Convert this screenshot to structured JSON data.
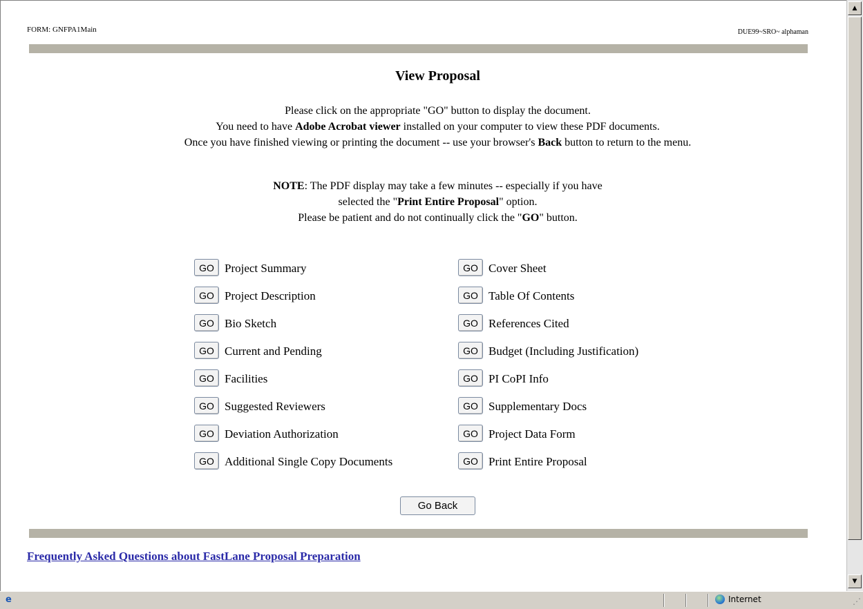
{
  "header": {
    "form_id": "FORM: GNFPA1Main",
    "session_id": "DUE99~SRO~ alphaman"
  },
  "page_title": "View Proposal",
  "intro": {
    "line1": "Please click on the appropriate \"GO\" button to display the document.",
    "line2_pre": "You need to have ",
    "line2_bold": "Adobe Acrobat viewer",
    "line2_post": " installed on your computer to view these PDF documents.",
    "line3_pre": "Once you have finished viewing or printing the document -- use your browser's ",
    "line3_bold": "Back",
    "line3_post": " button to return to the menu."
  },
  "note": {
    "label": "NOTE",
    "line1": ": The PDF display may take a few minutes -- especially if you have",
    "line2_pre": "selected the \"",
    "line2_bold": "Print Entire Proposal",
    "line2_post": "\" option.",
    "line3_pre": "Please be patient and do not continually click the \"",
    "line3_bold": "GO",
    "line3_post": "\" button."
  },
  "go_label": "GO",
  "left_items": [
    "Project Summary",
    "Project Description",
    "Bio Sketch",
    "Current and Pending",
    "Facilities",
    "Suggested Reviewers",
    "Deviation Authorization",
    "Additional Single Copy Documents"
  ],
  "right_items": [
    "Cover Sheet",
    "Table Of Contents",
    "References Cited",
    "Budget (Including Justification)",
    "PI CoPI Info",
    "Supplementary Docs",
    "Project Data Form",
    "Print Entire Proposal"
  ],
  "go_back_label": "Go Back",
  "faq_link": "Frequently Asked Questions about FastLane Proposal Preparation",
  "status": {
    "zone": "Internet"
  }
}
